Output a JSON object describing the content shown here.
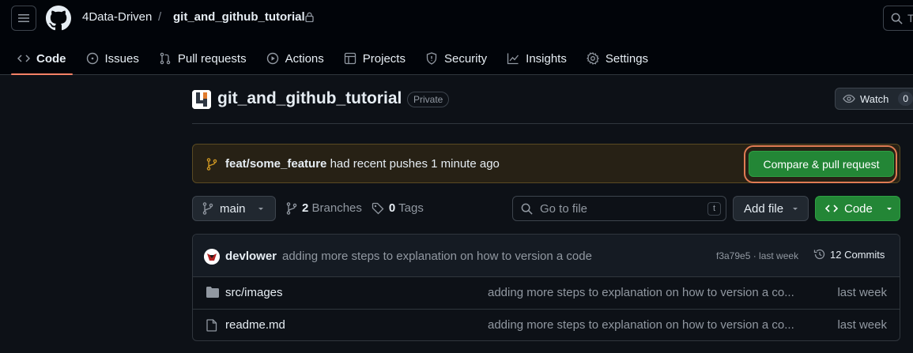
{
  "header": {
    "owner": "4Data-Driven",
    "separator": "/",
    "repo": "git_and_github_tutorial",
    "search_placeholder": "T"
  },
  "tabs": [
    {
      "label": "Code",
      "icon": "code-icon",
      "active": true
    },
    {
      "label": "Issues",
      "icon": "issue-icon",
      "active": false
    },
    {
      "label": "Pull requests",
      "icon": "pull-request-icon",
      "active": false
    },
    {
      "label": "Actions",
      "icon": "play-icon",
      "active": false
    },
    {
      "label": "Projects",
      "icon": "table-icon",
      "active": false
    },
    {
      "label": "Security",
      "icon": "shield-icon",
      "active": false
    },
    {
      "label": "Insights",
      "icon": "graph-icon",
      "active": false
    },
    {
      "label": "Settings",
      "icon": "gear-icon",
      "active": false
    }
  ],
  "repo_header": {
    "title": "git_and_github_tutorial",
    "visibility": "Private",
    "watch_label": "Watch",
    "watch_count": "0"
  },
  "banner": {
    "branch": "feat/some_feature",
    "message": "had recent pushes 1 minute ago",
    "button_label": "Compare & pull request"
  },
  "toolbar": {
    "branch": "main",
    "branches_count": "2",
    "branches_label": "Branches",
    "tags_count": "0",
    "tags_label": "Tags",
    "go_to_file_placeholder": "Go to file",
    "shortcut_key": "t",
    "add_file_label": "Add file",
    "code_label": "Code"
  },
  "latest_commit": {
    "author": "devlower",
    "message": "adding more steps to explanation on how to version a code",
    "meta": "f3a79e5 · last week",
    "commits_label": "12 Commits"
  },
  "files": [
    {
      "name": "src/images",
      "type": "folder",
      "message": "adding more steps to explanation on how to version a co...",
      "time": "last week"
    },
    {
      "name": "readme.md",
      "type": "file",
      "message": "adding more steps to explanation on how to version a co...",
      "time": "last week"
    }
  ],
  "colors": {
    "accent_green": "#238636",
    "tab_underline": "#f78166",
    "highlight_ring": "#e07b53",
    "background": "#0d1117"
  }
}
